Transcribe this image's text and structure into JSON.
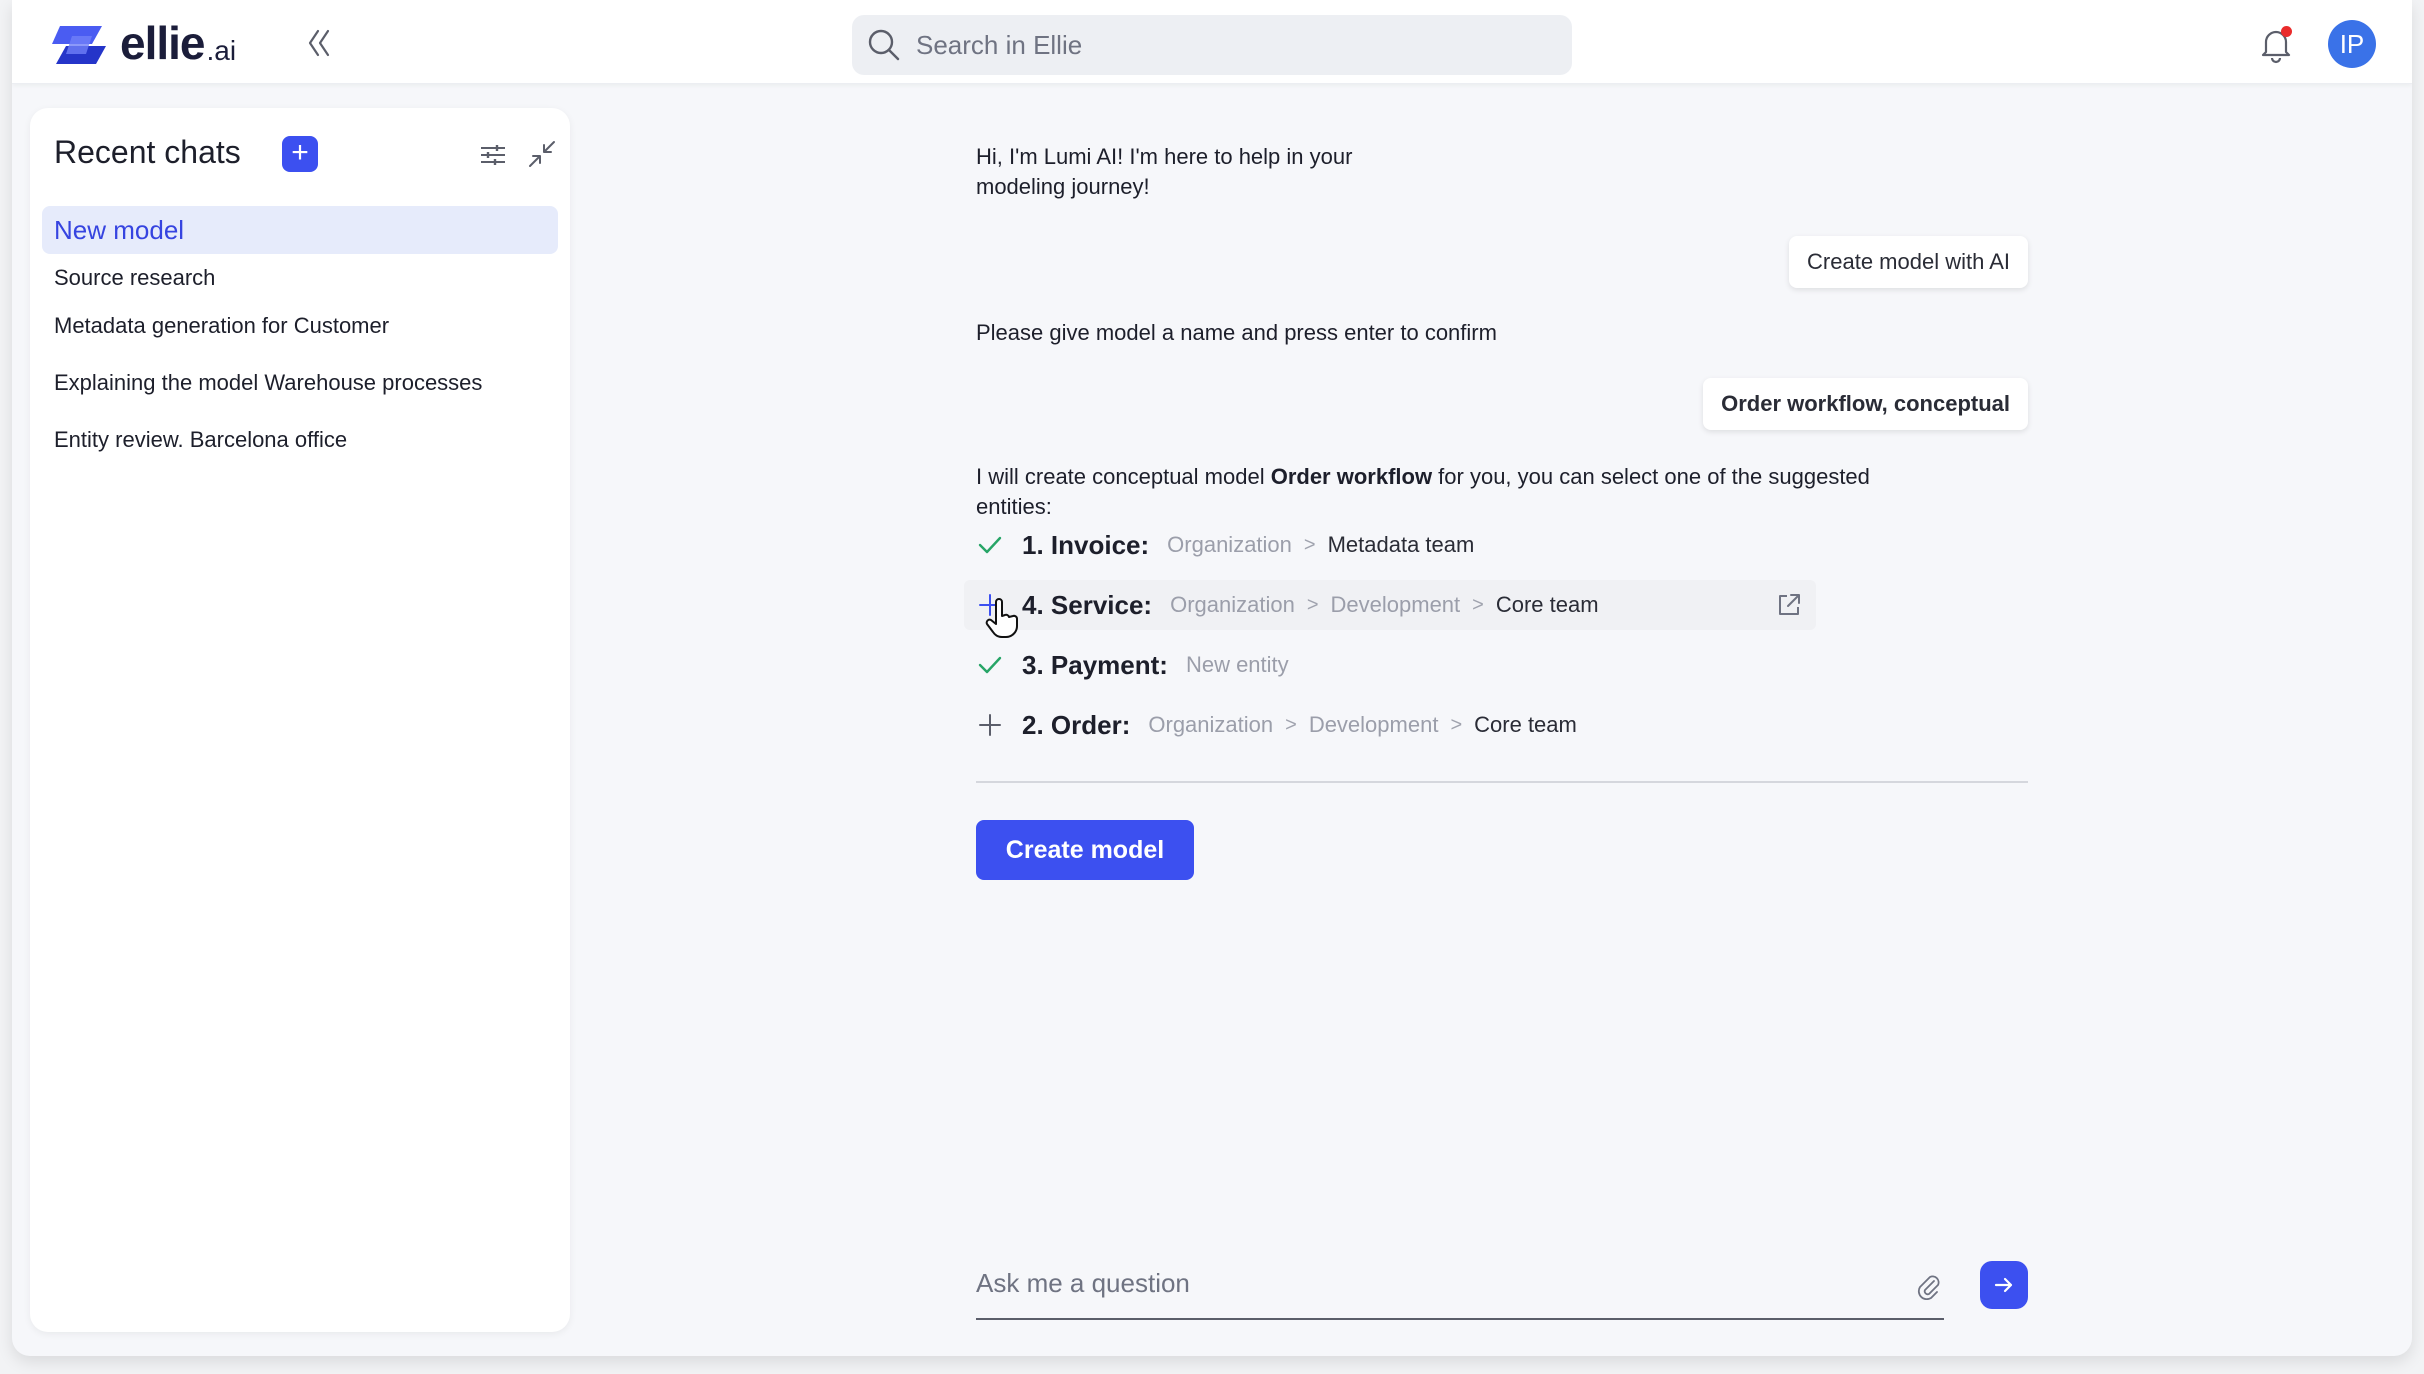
{
  "header": {
    "brand": "ellie",
    "brand_suffix": ".ai",
    "search_placeholder": "Search in Ellie",
    "avatar_initials": "IP"
  },
  "sidebar": {
    "title": "Recent chats",
    "add_label": "+",
    "items": [
      {
        "label": "New model"
      },
      {
        "label": "Source research"
      },
      {
        "label": "Metadata generation for Customer"
      },
      {
        "label": "Explaining the model Warehouse processes"
      },
      {
        "label": "Entity review. Barcelona office"
      }
    ]
  },
  "chat": {
    "bot_greeting": "Hi, I'm Lumi AI! I'm here to help in your modeling journey!",
    "user_msg_1": "Create model with AI",
    "bot_prompt_name": "Please give model a name and press enter to confirm",
    "user_msg_2": "Order workflow, conceptual",
    "bot_entities_pre": "I will create conceptual model ",
    "bot_entities_bold": "Order workflow",
    "bot_entities_post": " for you, you can select one of the suggested entities:",
    "entities": [
      {
        "name": "1. Invoice:",
        "state": "selected",
        "path": [
          "Organization",
          "Metadata team"
        ]
      },
      {
        "name": "4. Service:",
        "state": "add",
        "path": [
          "Organization",
          "Development",
          "Core team"
        ]
      },
      {
        "name": "3. Payment:",
        "state": "selected",
        "path": [
          "New entity"
        ]
      },
      {
        "name": "2. Order:",
        "state": "add",
        "path": [
          "Organization",
          "Development",
          "Core team"
        ]
      }
    ],
    "separator": ">",
    "create_button": "Create model",
    "ask_placeholder": "Ask me a question"
  },
  "colors": {
    "accent": "#3c50f0",
    "check": "#27a567",
    "notification": "#ea2b2b",
    "avatar": "#3a72e8"
  }
}
